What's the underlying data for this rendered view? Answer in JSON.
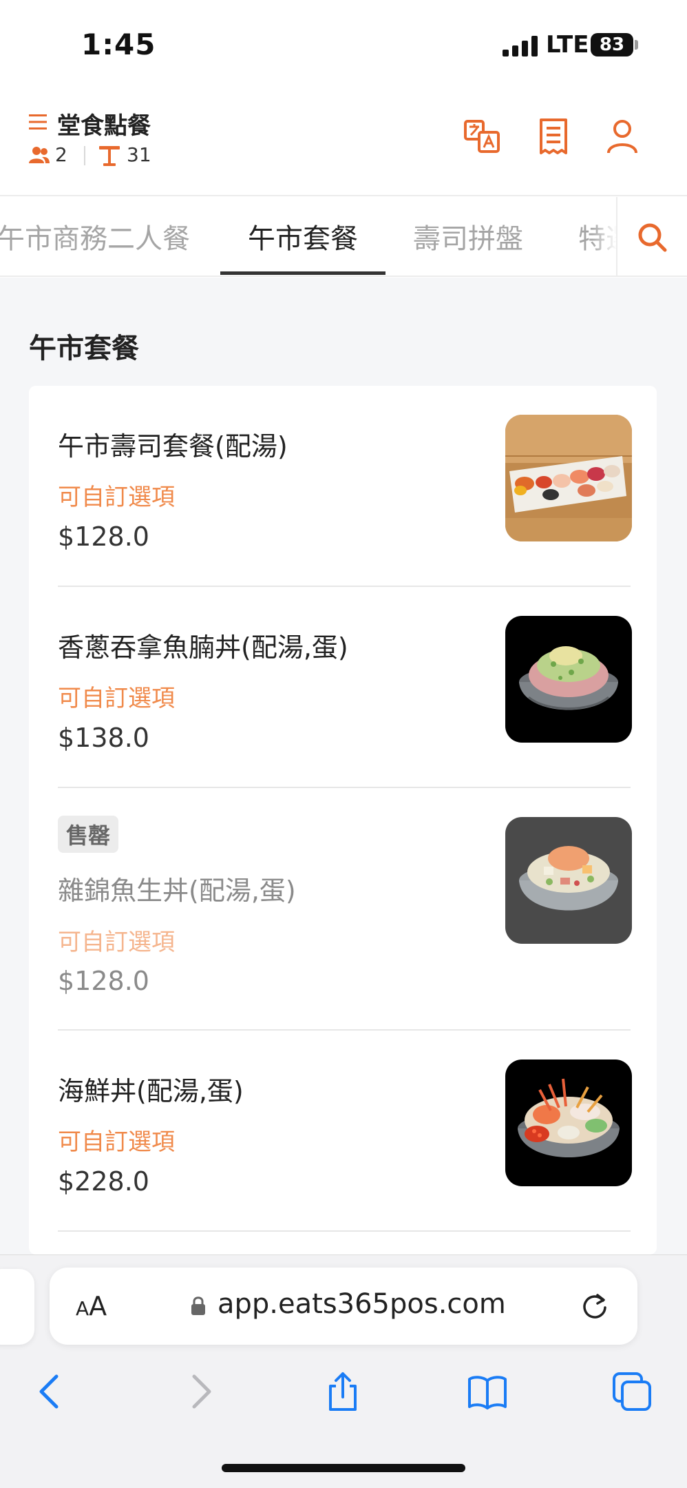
{
  "status_bar": {
    "time": "1:45",
    "network": "LTE",
    "battery": "83"
  },
  "header": {
    "title": "堂食點餐",
    "guests": "2",
    "table": "31"
  },
  "tabs": [
    "午市商務二人餐",
    "午市套餐",
    "壽司拼盤",
    "特選"
  ],
  "active_tab": 1,
  "section_title": "午市套餐",
  "items": [
    {
      "name": "午市壽司套餐(配湯)",
      "custom_label": "可自訂選項",
      "price": "$128.0",
      "sold_out": false
    },
    {
      "name": "香蔥吞拿魚腩丼(配湯,蛋)",
      "custom_label": "可自訂選項",
      "price": "$138.0",
      "sold_out": false
    },
    {
      "badge": "售罄",
      "name": "雜錦魚生丼(配湯,蛋)",
      "custom_label": "可自訂選項",
      "price": "$128.0",
      "sold_out": true
    },
    {
      "name": "海鮮丼(配湯,蛋)",
      "custom_label": "可自訂選項",
      "price": "$228.0",
      "sold_out": false
    }
  ],
  "browser": {
    "text_size_label_small": "A",
    "text_size_label_large": "A",
    "url": "app.eats365pos.com"
  },
  "colors": {
    "accent": "#f08a4b",
    "icon_accent": "#e8692d",
    "ios_blue": "#1a7cf5"
  },
  "icons": [
    "menu-icon",
    "people-icon",
    "table-icon",
    "translate-icon",
    "receipt-icon",
    "account-icon",
    "search-icon",
    "lock-icon",
    "reload-icon",
    "back-icon",
    "forward-icon",
    "share-icon",
    "bookmarks-icon",
    "tabs-icon"
  ]
}
